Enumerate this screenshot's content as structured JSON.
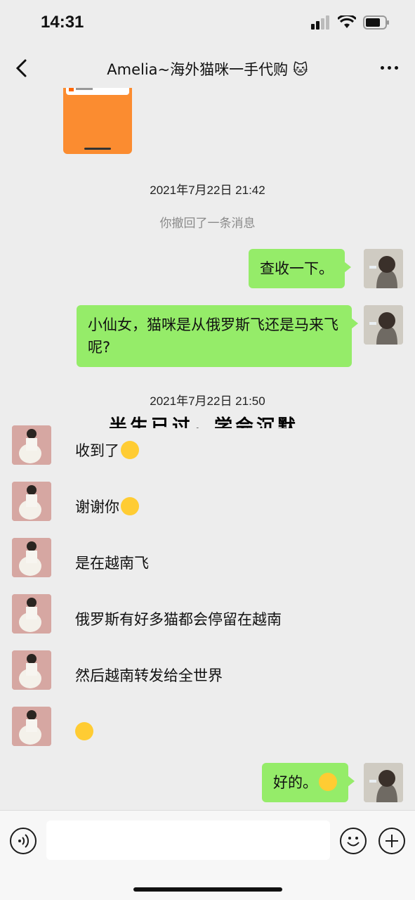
{
  "status": {
    "time": "14:31"
  },
  "nav": {
    "title": "Amelia~海外猫咪一手代购 🐱"
  },
  "chat": {
    "timestamp1": "2021年7月22日 21:42",
    "recall_note": "你撤回了一条消息",
    "timestamp2": "2021年7月22日 21:50",
    "overlay_text": "半生已过，学会沉默",
    "messages": [
      {
        "from": "me",
        "text": "查收一下。"
      },
      {
        "from": "me",
        "text": "小仙女，猫咪是从俄罗斯飞还是马来飞呢?"
      },
      {
        "from": "her",
        "text": "收到了",
        "emoji": "heart-eyes-emoji"
      },
      {
        "from": "her",
        "text": "谢谢你",
        "emoji": "grin-emoji"
      },
      {
        "from": "her",
        "text": "是在越南飞"
      },
      {
        "from": "her",
        "text": "俄罗斯有好多猫都会停留在越南"
      },
      {
        "from": "her",
        "text": "然后越南转发给全世界"
      },
      {
        "from": "her",
        "text": "",
        "emoji": "thinking-emoji"
      },
      {
        "from": "me",
        "text": "好的。",
        "emoji": "ok-hand-emoji"
      }
    ]
  },
  "input": {
    "value": ""
  },
  "colors": {
    "my_bubble": "#95ec69",
    "background": "#ededed",
    "image_card": "#fb8c30"
  }
}
